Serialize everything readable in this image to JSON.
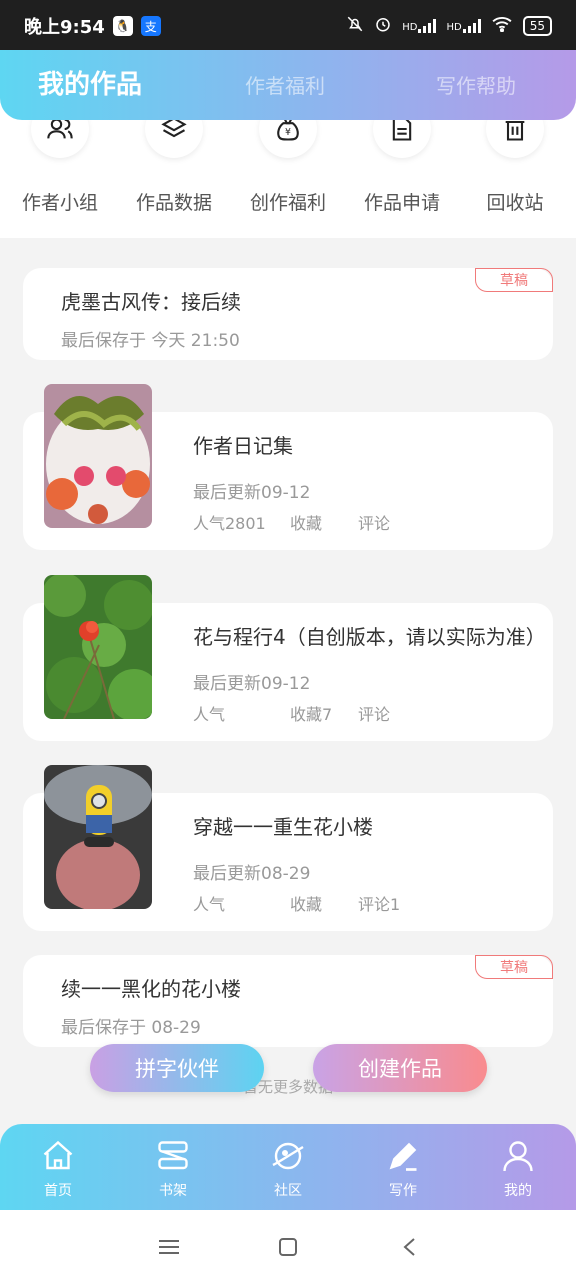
{
  "status": {
    "time": "晚上9:54",
    "battery": "55",
    "network": "HD"
  },
  "header": {
    "tabs": [
      "我的作品",
      "作者福利",
      "写作帮助"
    ]
  },
  "quick": [
    {
      "label": "作者小组",
      "icon": "group-icon"
    },
    {
      "label": "作品数据",
      "icon": "layers-icon"
    },
    {
      "label": "创作福利",
      "icon": "money-bag-icon"
    },
    {
      "label": "作品申请",
      "icon": "document-icon"
    },
    {
      "label": "回收站",
      "icon": "trash-icon"
    }
  ],
  "drafts": [
    {
      "title": "虎墨古风传：接后续",
      "saved": "最后保存于 今天 21:50",
      "badge": "草稿"
    },
    {
      "title": "续一一黑化的花小楼",
      "saved": "最后保存于 08-29",
      "badge": "草稿"
    }
  ],
  "works": [
    {
      "title": "作者日记集",
      "updated": "最后更新09-12",
      "popularity": "人气2801",
      "favorites": "收藏",
      "comments": "评论",
      "cover": "food-plate-photo"
    },
    {
      "title": "花与程行4（自创版本，请以实际为准）",
      "updated": "最后更新09-12",
      "popularity": "人气",
      "favorites": "收藏7",
      "comments": "评论",
      "cover": "red-flower-photo"
    },
    {
      "title": "穿越一一重生花小楼",
      "updated": "最后更新08-29",
      "popularity": "人气",
      "favorites": "收藏",
      "comments": "评论1",
      "cover": "minion-toy-photo"
    }
  ],
  "footer": {
    "no_more": "暂无更多数据"
  },
  "fab": {
    "partner": "拼字伙伴",
    "create": "创建作品"
  },
  "nav": [
    {
      "label": "首页",
      "icon": "home-icon"
    },
    {
      "label": "书架",
      "icon": "bookshelf-icon"
    },
    {
      "label": "社区",
      "icon": "planet-icon"
    },
    {
      "label": "写作",
      "icon": "pen-icon"
    },
    {
      "label": "我的",
      "icon": "profile-icon"
    }
  ]
}
